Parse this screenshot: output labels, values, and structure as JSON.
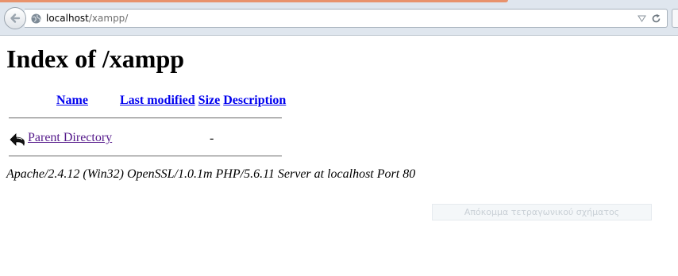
{
  "browser": {
    "url_host": "localhost",
    "url_path": "/xampp/"
  },
  "page": {
    "title": "Index of /xampp",
    "columns": {
      "name": "Name",
      "last_modified": "Last modified",
      "size": "Size",
      "description": "Description"
    },
    "rows": [
      {
        "name": "Parent Directory",
        "last_modified": "",
        "size": "-",
        "description": "",
        "icon": "back-arrow-icon"
      }
    ],
    "address": "Apache/2.4.12 (Win32) OpenSSL/1.0.1m PHP/5.6.11 Server at localhost Port 80"
  },
  "overlay": {
    "snip_tooltip": "Απόκομμα τετραγωνικού σχήματος"
  },
  "colors": {
    "link": "#0000ee",
    "visited_link": "#551a8b",
    "chrome": "#dfe6ee",
    "tab_accent": "#e8926c"
  }
}
